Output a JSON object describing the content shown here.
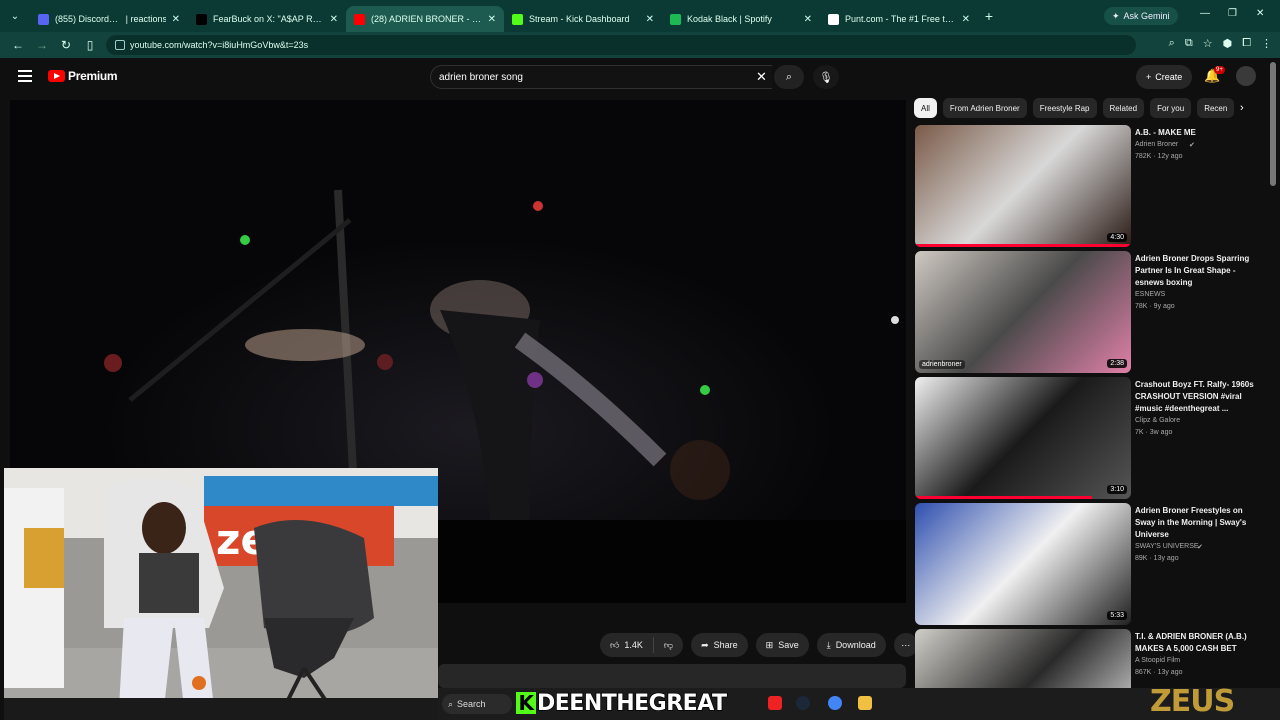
{
  "browser": {
    "tabs": [
      {
        "title": "(855) Discord | #",
        "suffix": "| reactions",
        "fav": "#5865f2",
        "active": false
      },
      {
        "title": "FearBuck on X: \"A$AP Rocky g",
        "fav": "#000000",
        "active": false
      },
      {
        "title": "(28) ADRIEN BRONER - Oh",
        "fav": "#ff0000",
        "active": true
      },
      {
        "title": "Stream - Kick Dashboard",
        "fav": "#53fc18",
        "active": false
      },
      {
        "title": "Kodak Black | Spotify",
        "fav": "#1db954",
        "active": false
      },
      {
        "title": "Punt.com - The #1 Free to Play",
        "fav": "#ffffff",
        "active": false
      }
    ],
    "ask_gemini": "Ask Gemini",
    "url": "youtube.com/watch?v=i8iuHmGoVbw&t=23s"
  },
  "youtube": {
    "brand": "Premium",
    "search_query": "adrien broner song",
    "create_label": "Create",
    "notification_count": "9+"
  },
  "actions": {
    "likes": "1.4K",
    "share": "Share",
    "save": "Save",
    "download": "Download"
  },
  "chips": [
    "All",
    "From Adrien Broner",
    "Freestyle Rap",
    "Related",
    "For you",
    "Recen"
  ],
  "recommendations": [
    {
      "title": "A.B. - MAKE ME",
      "channel": "Adrien Broner",
      "verified": true,
      "meta": "782K · 12y ago",
      "duration": "4:30",
      "progress": 1.0,
      "music": true
    },
    {
      "title": "Adrien Broner Drops Sparring Partner Is In Great Shape - esnews boxing",
      "channel": "ESNEWS",
      "verified": false,
      "meta": "78K · 9y ago",
      "duration": "2:38",
      "watermark": "adrienbroner",
      "progress": 0
    },
    {
      "title": "Crashout Boyz FT. Ralfy- 1960s CRASHOUT VERSION #viral #music #deenthegreat ...",
      "channel": "Clipz & Galore",
      "verified": false,
      "meta": "7K · 3w ago",
      "duration": "3:10",
      "progress": 0.82,
      "music": true
    },
    {
      "title": "Adrien Broner Freestyles on Sway in the Morning | Sway's Universe",
      "channel": "SWAY'S UNIVERSE",
      "verified": true,
      "meta": "89K · 13y ago",
      "duration": "5:33",
      "progress": 0
    },
    {
      "title": "T.I. & ADRIEN BRONER (A.B.) MAKES A 5,000 CASH BET",
      "channel": "A Stoopid Film",
      "verified": false,
      "meta": "867K · 13y ago",
      "duration": "",
      "progress": 0
    }
  ],
  "taskbar": {
    "search": "Search"
  },
  "overlay": {
    "streamer_name": "DEENTHEGREAT",
    "kick_letter": "K",
    "sponsor": "ZEUS",
    "webcam_banner": "zeus"
  }
}
